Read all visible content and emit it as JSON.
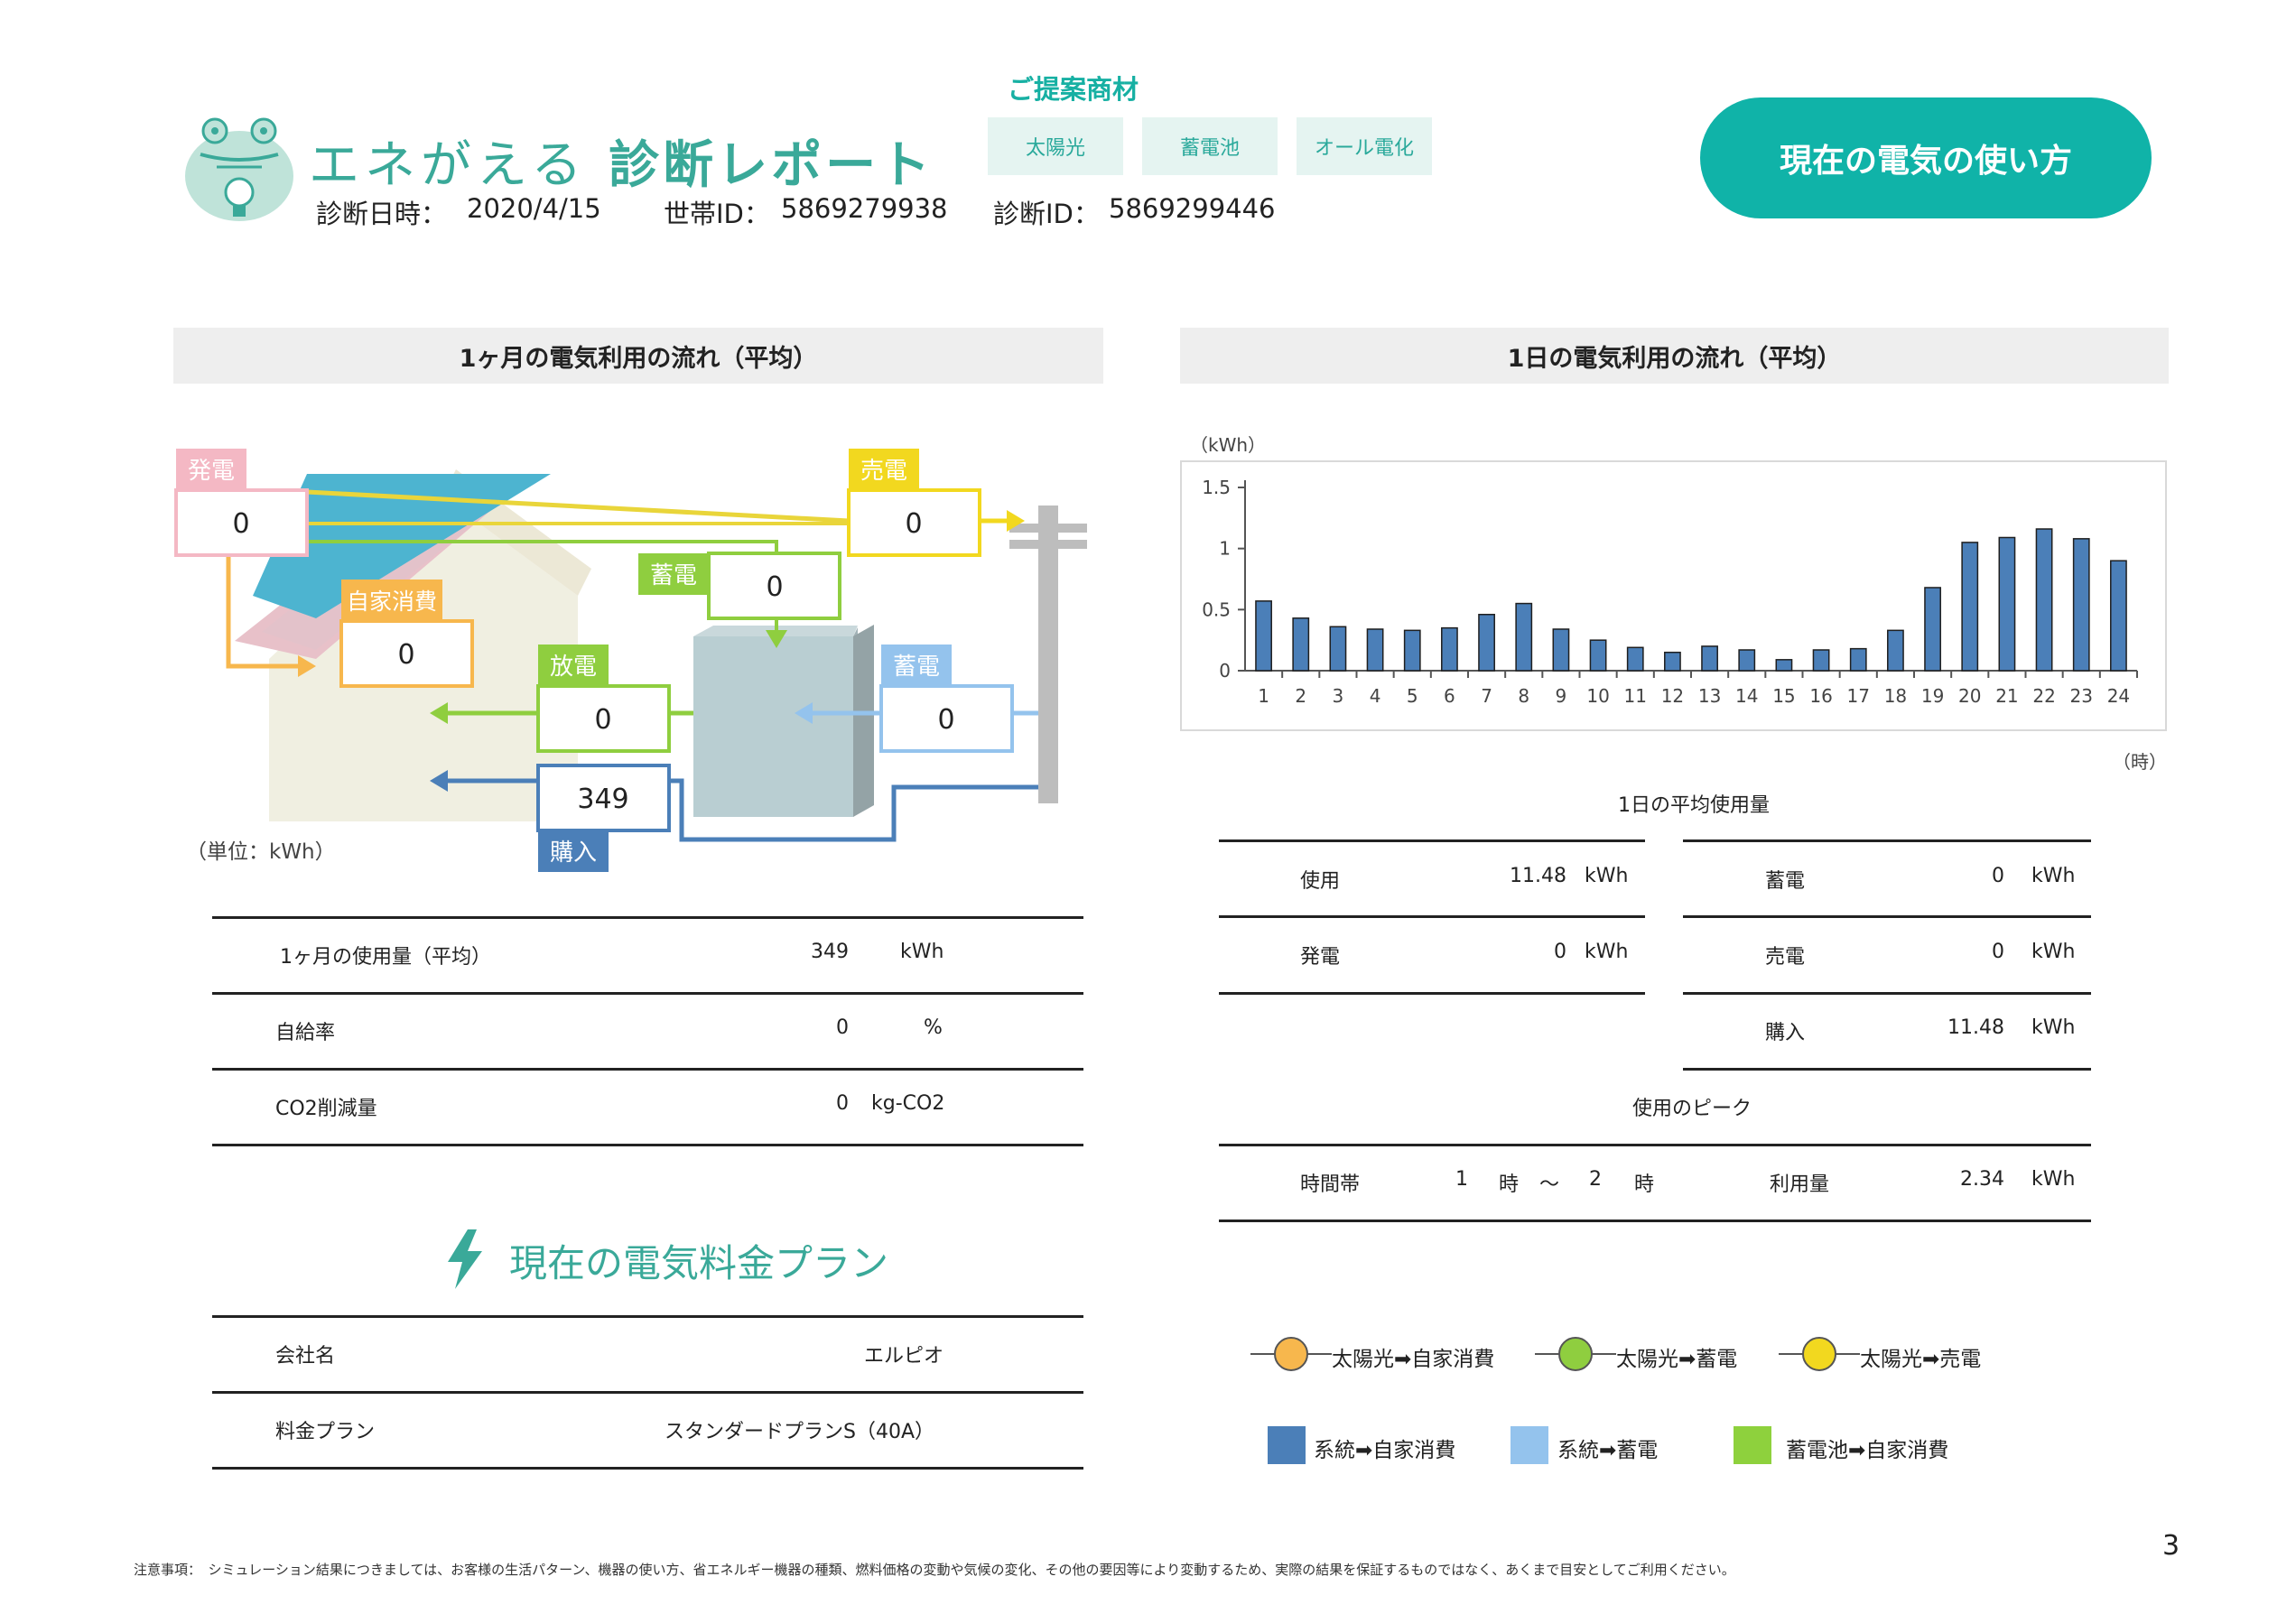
{
  "header": {
    "brand": "エネがえる",
    "report": "診断レポート",
    "date_label": "診断日時：",
    "date_value": "2020/4/15",
    "household_label": "世帯ID：",
    "household_value": "5869279938",
    "diagnosis_label": "診断ID：",
    "diagnosis_value": "5869299446",
    "proposal_label": "ご提案商材",
    "chips": [
      "太陽光",
      "蓄電池",
      "オール電化"
    ],
    "current_usage_button": "現在の電気の使い方"
  },
  "left_section": {
    "title": "1ヶ月の電気利用の流れ（平均）",
    "unit_note": "（単位：kWh）",
    "flow": {
      "generation_label": "発電",
      "generation_value": "0",
      "self_consumption_label": "自家消費",
      "self_consumption_value": "0",
      "sale_label": "売電",
      "sale_value": "0",
      "charge_label": "蓄電",
      "charge_value": "0",
      "discharge_label": "放電",
      "discharge_value": "0",
      "grid_charge_label": "蓄電",
      "grid_charge_value": "0",
      "purchase_label": "購入",
      "purchase_value": "349"
    },
    "summary": [
      {
        "label": "1ヶ月の使用量（平均）",
        "value": "349",
        "unit": "kWh"
      },
      {
        "label": "自給率",
        "value": "0",
        "unit": "%"
      },
      {
        "label": "CO2削減量",
        "value": "0",
        "unit": "kg-CO2"
      }
    ]
  },
  "plan": {
    "title": "現在の電気料金プラン",
    "rows": [
      {
        "label": "会社名",
        "value": "エルピオ"
      },
      {
        "label": "料金プラン",
        "value": "スタンダードプランS（40A）"
      }
    ]
  },
  "right_section": {
    "title": "1日の電気利用の流れ（平均）",
    "daily_avg_label": "1日の平均使用量",
    "daily": [
      {
        "label": "使用",
        "value": "11.48",
        "unit": "kWh"
      },
      {
        "label": "発電",
        "value": "0",
        "unit": "kWh"
      },
      {
        "label": "蓄電",
        "value": "0",
        "unit": "kWh"
      },
      {
        "label": "売電",
        "value": "0",
        "unit": "kWh"
      },
      {
        "label": "購入",
        "value": "11.48",
        "unit": "kWh"
      }
    ],
    "peak_label": "使用のピーク",
    "peak": {
      "time_label": "時間帯",
      "from": "1",
      "from_unit": "時",
      "tilde": "～",
      "to": "2",
      "to_unit": "時",
      "usage_label": "利用量",
      "usage_value": "2.34",
      "usage_unit": "kWh"
    }
  },
  "chart_data": {
    "type": "bar",
    "y_unit": "（kWh）",
    "x_unit": "（時）",
    "categories": [
      "1",
      "2",
      "3",
      "4",
      "5",
      "6",
      "7",
      "8",
      "9",
      "10",
      "11",
      "12",
      "13",
      "14",
      "15",
      "16",
      "17",
      "18",
      "19",
      "20",
      "21",
      "22",
      "23",
      "24"
    ],
    "values": [
      0.57,
      0.43,
      0.36,
      0.34,
      0.33,
      0.35,
      0.46,
      0.55,
      0.34,
      0.25,
      0.19,
      0.15,
      0.2,
      0.17,
      0.09,
      0.17,
      0.18,
      0.33,
      0.68,
      1.05,
      1.09,
      1.16,
      1.08,
      0.9
    ],
    "ylim": [
      0,
      1.5
    ],
    "yticks": [
      "0",
      "0.5",
      "1",
      "1.5"
    ],
    "color": "#4b7fb8"
  },
  "legend": {
    "lines": [
      {
        "label": "太陽光➡自家消費",
        "color": "#f7b74d"
      },
      {
        "label": "太陽光➡蓄電",
        "color": "#8fce3f"
      },
      {
        "label": "太陽光➡売電",
        "color": "#f2d81f"
      }
    ],
    "boxes": [
      {
        "label": "系統➡自家消費",
        "color": "#4b7fb8"
      },
      {
        "label": "系統➡蓄電",
        "color": "#94c3ed"
      },
      {
        "label": "蓄電池➡自家消費",
        "color": "#8ed13d"
      }
    ]
  },
  "footer": {
    "note": "注意事項：　シミュレーション結果につきましては、お客様の生活パターン、機器の使い方、省エネルギー機器の種類、燃料価格の変動や気候の変化、その他の要因等により変動するため、実際の結果を保証するものではなく、あくまで目安としてご利用ください。",
    "page": "3"
  }
}
